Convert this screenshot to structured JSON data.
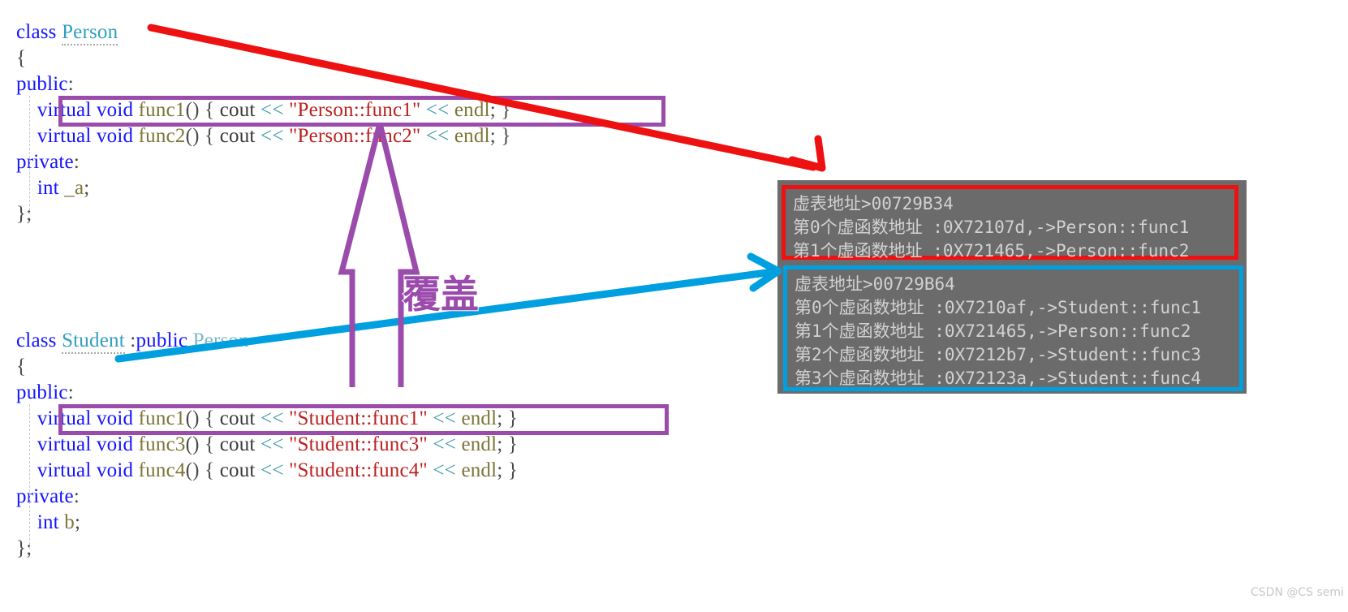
{
  "meta": {
    "watermark": "CSDN @CS semi"
  },
  "colors": {
    "keyword": "#1414ff",
    "type": "#2f9fbf",
    "function": "#7d7536",
    "string": "#bb2020",
    "operator": "#3f9aa6",
    "highlight_purple": "#9b4bab",
    "arrow_red": "#ee1111",
    "arrow_blue": "#00a0e0",
    "console_bg": "#6b6b6b",
    "console_fg": "#d2d2d2"
  },
  "person_class": {
    "lines": [
      {
        "indent": 0,
        "tokens": [
          {
            "t": "class",
            "c": "kw"
          },
          {
            "t": " ",
            "c": "plain"
          },
          {
            "t": "Person",
            "c": "type",
            "underline": true
          }
        ]
      },
      {
        "indent": 0,
        "tokens": [
          {
            "t": "{",
            "c": "punc"
          }
        ]
      },
      {
        "indent": 0,
        "tokens": [
          {
            "t": "public",
            "c": "kw"
          },
          {
            "t": ":",
            "c": "punc"
          }
        ]
      },
      {
        "indent": 1,
        "tokens": [
          {
            "t": "virtual",
            "c": "kw"
          },
          {
            "t": " ",
            "c": "plain"
          },
          {
            "t": "void",
            "c": "kw"
          },
          {
            "t": " ",
            "c": "plain"
          },
          {
            "t": "func1",
            "c": "fn"
          },
          {
            "t": "()",
            "c": "punc"
          },
          {
            "t": " { ",
            "c": "punc"
          },
          {
            "t": "cout",
            "c": "plain"
          },
          {
            "t": " ",
            "c": "plain"
          },
          {
            "t": "<<",
            "c": "op"
          },
          {
            "t": " ",
            "c": "plain"
          },
          {
            "t": "\"Person::func1\"",
            "c": "str"
          },
          {
            "t": " ",
            "c": "plain"
          },
          {
            "t": "<<",
            "c": "op"
          },
          {
            "t": " ",
            "c": "plain"
          },
          {
            "t": "endl",
            "c": "fn"
          },
          {
            "t": "; }",
            "c": "punc"
          }
        ]
      },
      {
        "indent": 1,
        "tokens": [
          {
            "t": "virtual",
            "c": "kw"
          },
          {
            "t": " ",
            "c": "plain"
          },
          {
            "t": "void",
            "c": "kw"
          },
          {
            "t": " ",
            "c": "plain"
          },
          {
            "t": "func2",
            "c": "fn"
          },
          {
            "t": "()",
            "c": "punc"
          },
          {
            "t": " { ",
            "c": "punc"
          },
          {
            "t": "cout",
            "c": "plain"
          },
          {
            "t": " ",
            "c": "plain"
          },
          {
            "t": "<<",
            "c": "op"
          },
          {
            "t": " ",
            "c": "plain"
          },
          {
            "t": "\"Person::func2\"",
            "c": "str"
          },
          {
            "t": " ",
            "c": "plain"
          },
          {
            "t": "<<",
            "c": "op"
          },
          {
            "t": " ",
            "c": "plain"
          },
          {
            "t": "endl",
            "c": "fn"
          },
          {
            "t": "; }",
            "c": "punc"
          }
        ]
      },
      {
        "indent": 0,
        "tokens": [
          {
            "t": "private",
            "c": "kw"
          },
          {
            "t": ":",
            "c": "punc"
          }
        ]
      },
      {
        "indent": 1,
        "tokens": [
          {
            "t": "int",
            "c": "kw"
          },
          {
            "t": " ",
            "c": "plain"
          },
          {
            "t": "_a",
            "c": "var"
          },
          {
            "t": ";",
            "c": "punc"
          }
        ]
      },
      {
        "indent": 0,
        "tokens": [
          {
            "t": "};",
            "c": "punc"
          }
        ]
      }
    ]
  },
  "student_class": {
    "lines": [
      {
        "indent": 0,
        "tokens": [
          {
            "t": "class",
            "c": "kw"
          },
          {
            "t": " ",
            "c": "plain"
          },
          {
            "t": "Student",
            "c": "type",
            "underline": true
          },
          {
            "t": " :",
            "c": "punc"
          },
          {
            "t": "public",
            "c": "kw"
          },
          {
            "t": " ",
            "c": "plain"
          },
          {
            "t": "Person",
            "c": "base"
          }
        ]
      },
      {
        "indent": 0,
        "tokens": [
          {
            "t": "{",
            "c": "punc"
          }
        ]
      },
      {
        "indent": 0,
        "tokens": [
          {
            "t": "public",
            "c": "kw"
          },
          {
            "t": ":",
            "c": "punc"
          }
        ]
      },
      {
        "indent": 1,
        "tokens": [
          {
            "t": "virtual",
            "c": "kw"
          },
          {
            "t": " ",
            "c": "plain"
          },
          {
            "t": "void",
            "c": "kw"
          },
          {
            "t": " ",
            "c": "plain"
          },
          {
            "t": "func1",
            "c": "fn"
          },
          {
            "t": "()",
            "c": "punc"
          },
          {
            "t": " { ",
            "c": "punc"
          },
          {
            "t": "cout",
            "c": "plain"
          },
          {
            "t": " ",
            "c": "plain"
          },
          {
            "t": "<<",
            "c": "op"
          },
          {
            "t": " ",
            "c": "plain"
          },
          {
            "t": "\"Student::func1\"",
            "c": "str"
          },
          {
            "t": " ",
            "c": "plain"
          },
          {
            "t": "<<",
            "c": "op"
          },
          {
            "t": " ",
            "c": "plain"
          },
          {
            "t": "endl",
            "c": "fn"
          },
          {
            "t": "; }",
            "c": "punc"
          }
        ]
      },
      {
        "indent": 1,
        "tokens": [
          {
            "t": "virtual",
            "c": "kw"
          },
          {
            "t": " ",
            "c": "plain"
          },
          {
            "t": "void",
            "c": "kw"
          },
          {
            "t": " ",
            "c": "plain"
          },
          {
            "t": "func3",
            "c": "fn"
          },
          {
            "t": "()",
            "c": "punc"
          },
          {
            "t": " { ",
            "c": "punc"
          },
          {
            "t": "cout",
            "c": "plain"
          },
          {
            "t": " ",
            "c": "plain"
          },
          {
            "t": "<<",
            "c": "op"
          },
          {
            "t": " ",
            "c": "plain"
          },
          {
            "t": "\"Student::func3\"",
            "c": "str"
          },
          {
            "t": " ",
            "c": "plain"
          },
          {
            "t": "<<",
            "c": "op"
          },
          {
            "t": " ",
            "c": "plain"
          },
          {
            "t": "endl",
            "c": "fn"
          },
          {
            "t": "; }",
            "c": "punc"
          }
        ]
      },
      {
        "indent": 1,
        "tokens": [
          {
            "t": "virtual",
            "c": "kw"
          },
          {
            "t": " ",
            "c": "plain"
          },
          {
            "t": "void",
            "c": "kw"
          },
          {
            "t": " ",
            "c": "plain"
          },
          {
            "t": "func4",
            "c": "fn"
          },
          {
            "t": "()",
            "c": "punc"
          },
          {
            "t": " { ",
            "c": "punc"
          },
          {
            "t": "cout",
            "c": "plain"
          },
          {
            "t": " ",
            "c": "plain"
          },
          {
            "t": "<<",
            "c": "op"
          },
          {
            "t": " ",
            "c": "plain"
          },
          {
            "t": "\"Student::func4\"",
            "c": "str"
          },
          {
            "t": " ",
            "c": "plain"
          },
          {
            "t": "<<",
            "c": "op"
          },
          {
            "t": " ",
            "c": "plain"
          },
          {
            "t": "endl",
            "c": "fn"
          },
          {
            "t": "; }",
            "c": "punc"
          }
        ]
      },
      {
        "indent": 0,
        "tokens": [
          {
            "t": "private",
            "c": "kw"
          },
          {
            "t": ":",
            "c": "punc"
          }
        ]
      },
      {
        "indent": 1,
        "tokens": [
          {
            "t": "int",
            "c": "kw"
          },
          {
            "t": " ",
            "c": "plain"
          },
          {
            "t": "b",
            "c": "var"
          },
          {
            "t": ";",
            "c": "punc"
          }
        ]
      },
      {
        "indent": 0,
        "tokens": [
          {
            "t": "};",
            "c": "punc"
          }
        ]
      }
    ]
  },
  "annotation": {
    "override_label": "覆盖"
  },
  "person_vtable": {
    "lines": [
      "虚表地址>00729B34",
      "第0个虚函数地址 :0X72107d,->Person::func1",
      "第1个虚函数地址 :0X721465,->Person::func2"
    ]
  },
  "student_vtable": {
    "lines": [
      "虚表地址>00729B64",
      "第0个虚函数地址 :0X7210af,->Student::func1",
      "第1个虚函数地址 :0X721465,->Person::func2",
      "第2个虚函数地址 :0X7212b7,->Student::func3",
      "第3个虚函数地址 :0X72123a,->Student::func4"
    ]
  }
}
